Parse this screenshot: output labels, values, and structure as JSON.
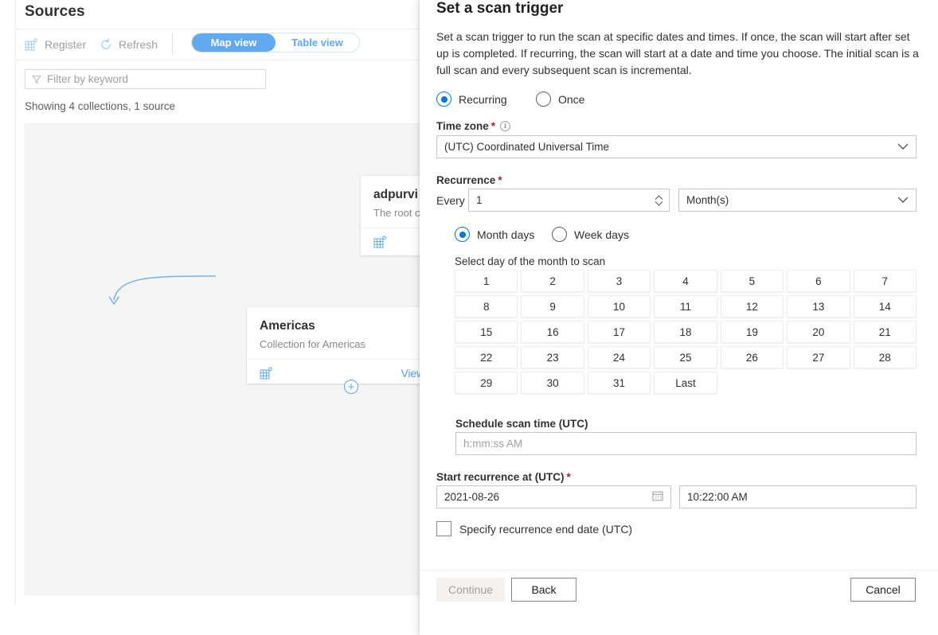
{
  "background": {
    "page_title": "Sources",
    "commands": [
      {
        "label": "Register",
        "icon": "register-grid-icon"
      },
      {
        "label": "Refresh",
        "icon": "refresh-icon"
      }
    ],
    "view_toggle": {
      "active": "Map view",
      "inactive": "Table view",
      "active_color": "#60a9f0"
    },
    "filter": {
      "placeholder": "Filter by keyword",
      "icon": "filter-funnel-icon"
    },
    "status_text": "Showing 4 collections, 1 source",
    "cards": [
      {
        "title": "adpurvi",
        "subtitle": "The root c",
        "icon": "collection-grid-icon",
        "link": ""
      },
      {
        "title": "Americas",
        "subtitle": "Collection for Americas",
        "icon": "collection-grid-icon",
        "link": "View d"
      }
    ],
    "add_node_icon": "plus-circle-icon"
  },
  "panel": {
    "title": "Set a scan trigger",
    "description": "Set a scan trigger to run the scan at specific dates and times. If once, the scan will start after set up is completed. If recurring, the scan will start at a date and time you choose. The initial scan is a full scan and every subsequent scan is incremental.",
    "trigger_mode": {
      "selected": "Recurring",
      "options": [
        {
          "label": "Recurring",
          "checked": true
        },
        {
          "label": "Once",
          "checked": false
        }
      ]
    },
    "time_zone": {
      "label": "Time zone",
      "required": "*",
      "info_icon": "info-circle-icon",
      "value": "(UTC) Coordinated Universal Time",
      "chevron": "chevron-down-icon"
    },
    "recurrence": {
      "label": "Recurrence",
      "required": "*",
      "every_label": "Every",
      "every_value": "1",
      "unit_value": "Month(s)",
      "unit_chevron": "chevron-down-icon",
      "stepper_up": "chevron-up-icon",
      "stepper_down": "chevron-down-icon",
      "day_mode": {
        "options": [
          {
            "label": "Month days",
            "checked": true
          },
          {
            "label": "Week days",
            "checked": false
          }
        ]
      }
    },
    "day_picker": {
      "heading": "Select day of the month to scan",
      "days": [
        "1",
        "2",
        "3",
        "4",
        "5",
        "6",
        "7",
        "8",
        "9",
        "10",
        "11",
        "12",
        "13",
        "14",
        "15",
        "16",
        "17",
        "18",
        "19",
        "20",
        "21",
        "22",
        "23",
        "24",
        "25",
        "26",
        "27",
        "28",
        "29",
        "30",
        "31",
        "Last"
      ]
    },
    "schedule_scan_time": {
      "label": "Schedule scan time (UTC)",
      "placeholder": "h:mm:ss AM",
      "value": ""
    },
    "start_recurrence": {
      "label": "Start recurrence at (UTC)",
      "required": "*",
      "date_value": "2021-08-26",
      "date_icon": "calendar-icon",
      "time_value": "10:22:00 AM"
    },
    "end_date_checkbox": {
      "label": "Specify recurrence end date (UTC)",
      "checked": false
    },
    "footer": {
      "continue_label": "Continue",
      "continue_disabled": true,
      "back_label": "Back",
      "cancel_label": "Cancel"
    }
  },
  "colors": {
    "accent_blue": "#0078d4",
    "toggle_blue": "#60a9f0",
    "link_blue": "#4a9ae4",
    "required_red": "#a4262c",
    "canvas_gray": "#f5f5f5"
  }
}
